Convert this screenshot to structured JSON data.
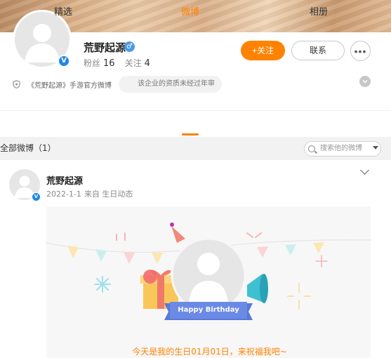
{
  "profile": {
    "name": "荒野起源",
    "followers_label": "粉丝",
    "followers": "16",
    "following_label": "关注",
    "following": "4",
    "verified_badge": "V",
    "gender_symbol": "♂",
    "certification": "《荒野起源》手游官方微博",
    "certification_note": "该企业的资质未经过年审"
  },
  "actions": {
    "follow_label": "+关注",
    "contact_label": "联系",
    "more_label": "•••"
  },
  "tabs": [
    {
      "label": "精选"
    },
    {
      "label": "微博"
    },
    {
      "label": "相册"
    }
  ],
  "filter": {
    "label": "全部微博（1）",
    "search_placeholder": "搜索他的微博"
  },
  "post": {
    "author": "荒野起源",
    "date": "2022-1-1",
    "source": "来自 生日动态",
    "banner_text": "Happy Birthday",
    "caption": "今天是我的生日01月01日，来祝福我吧~"
  },
  "colors": {
    "accent": "#ff8200",
    "verified": "#1e88e5"
  },
  "icons": {
    "shield": "shield-icon",
    "search": "search-icon",
    "expand": "chevron-down-icon"
  }
}
